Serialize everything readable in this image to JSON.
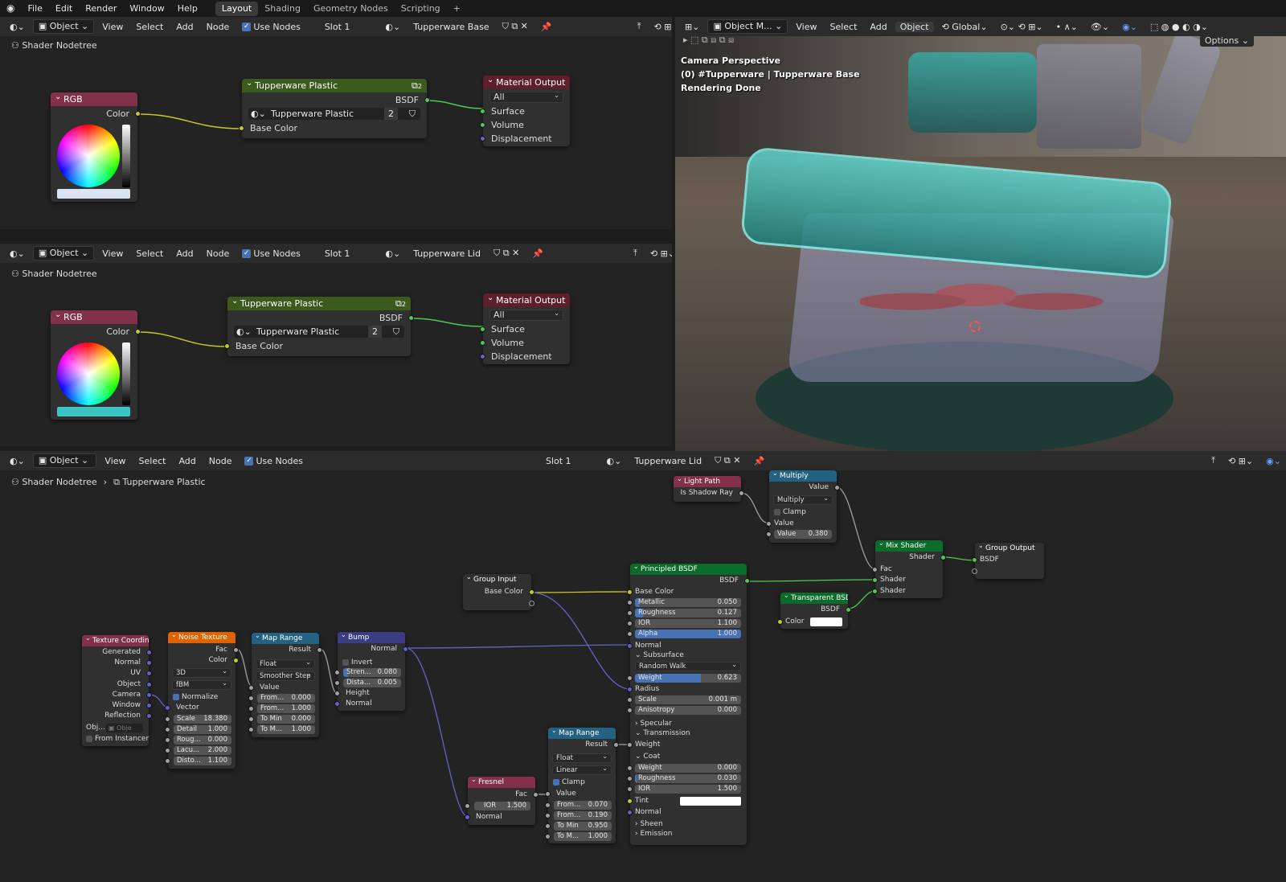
{
  "menu": {
    "items": [
      "File",
      "Edit",
      "Render",
      "Window",
      "Help"
    ],
    "workspaces": [
      "Layout",
      "Shading",
      "Geometry Nodes",
      "Scripting"
    ],
    "add_tab": "+"
  },
  "editor1": {
    "mode": "Object",
    "menus": [
      "View",
      "Select",
      "Add",
      "Node"
    ],
    "use_nodes": "Use Nodes",
    "slot": "Slot 1",
    "material": "Tupperware Base",
    "breadcrumb": "Shader Nodetree",
    "rgb": {
      "title": "RGB",
      "out": "Color",
      "swatch_color": "#dbe4f2"
    },
    "group": {
      "title": "Tupperware Plastic",
      "badge": "2",
      "out": "BSDF",
      "name": "Tupperware Plastic",
      "users": "2",
      "in": "Base Color"
    },
    "output": {
      "title": "Material Output",
      "target": "All",
      "inputs": [
        "Surface",
        "Volume",
        "Displacement"
      ]
    }
  },
  "editor2": {
    "mode": "Object",
    "menus": [
      "View",
      "Select",
      "Add",
      "Node"
    ],
    "use_nodes": "Use Nodes",
    "slot": "Slot 1",
    "material": "Tupperware Lid",
    "breadcrumb": "Shader Nodetree",
    "rgb": {
      "title": "RGB",
      "out": "Color",
      "swatch_color": "#3cc4c2"
    },
    "group": {
      "title": "Tupperware Plastic",
      "badge": "2",
      "out": "BSDF",
      "name": "Tupperware Plastic",
      "users": "2",
      "in": "Base Color"
    },
    "output": {
      "title": "Material Output",
      "target": "All",
      "inputs": [
        "Surface",
        "Volume",
        "Displacement"
      ]
    }
  },
  "viewport": {
    "mode": "Object M...",
    "menus": [
      "View",
      "Select",
      "Add",
      "Object"
    ],
    "orientation": "Global",
    "options": "Options",
    "overlay": [
      "Camera Perspective",
      "(0) #Tupperware | Tupperware Base",
      "Rendering Done"
    ]
  },
  "editor3": {
    "mode": "Object",
    "menus": [
      "View",
      "Select",
      "Add",
      "Node"
    ],
    "use_nodes": "Use Nodes",
    "slot": "Slot 1",
    "material": "Tupperware Lid",
    "breadcrumb": "Shader Nodetree",
    "breadcrumb2": "Tupperware Plastic",
    "texcoord": {
      "title": "Texture Coordin...",
      "outs": [
        "Generated",
        "Normal",
        "UV",
        "Object",
        "Camera",
        "Window",
        "Reflection"
      ],
      "obj": "Obj...",
      "obj_field": "Obje",
      "from_instancer": "From Instancer"
    },
    "noise": {
      "title": "Noise Texture",
      "outs": [
        "Fac",
        "Color"
      ],
      "dim": "3D",
      "type": "fBM",
      "normalize": "Normalize",
      "vector": "Vector",
      "fields": [
        {
          "l": "Scale",
          "v": "18.380"
        },
        {
          "l": "Detail",
          "v": "1.000"
        },
        {
          "l": "Roug...",
          "v": "0.000"
        },
        {
          "l": "Lacu...",
          "v": "2.000"
        },
        {
          "l": "Disto...",
          "v": "1.100"
        }
      ]
    },
    "maprange1": {
      "title": "Map Range",
      "out": "Result",
      "dtype": "Float",
      "interp": "Smoother Step",
      "value": "Value",
      "fields": [
        {
          "l": "From...",
          "v": "0.000"
        },
        {
          "l": "From...",
          "v": "1.000"
        },
        {
          "l": "To Min",
          "v": "0.000"
        },
        {
          "l": "To M...",
          "v": "1.000"
        }
      ]
    },
    "bump": {
      "title": "Bump",
      "out": "Normal",
      "invert": "Invert",
      "fields": [
        {
          "l": "Stren...",
          "v": "0.080"
        },
        {
          "l": "Dista...",
          "v": "0.005"
        }
      ],
      "ins": [
        "Height",
        "Normal"
      ]
    },
    "groupin": {
      "title": "Group Input",
      "out": "Base Color"
    },
    "fresnel": {
      "title": "Fresnel",
      "out": "Fac",
      "ior_l": "IOR",
      "ior_v": "1.500",
      "in": "Normal"
    },
    "maprange2": {
      "title": "Map Range",
      "out": "Result",
      "dtype": "Float",
      "interp": "Linear",
      "clamp": "Clamp",
      "value": "Value",
      "fields": [
        {
          "l": "From...",
          "v": "0.070"
        },
        {
          "l": "From...",
          "v": "0.190"
        },
        {
          "l": "To Min",
          "v": "0.950"
        },
        {
          "l": "To M...",
          "v": "1.000"
        }
      ]
    },
    "principled": {
      "title": "Principled BSDF",
      "out": "BSDF",
      "base": "Base Color",
      "fields": [
        {
          "l": "Metallic",
          "v": "0.050"
        },
        {
          "l": "Roughness",
          "v": "0.127"
        },
        {
          "l": "IOR",
          "v": "1.100"
        },
        {
          "l": "Alpha",
          "v": "1.000"
        }
      ],
      "normal": "Normal",
      "subsurface": "Subsurface",
      "ss_method": "Random Walk",
      "ss_fields": [
        {
          "l": "Weight",
          "v": "0.623"
        }
      ],
      "radius": "Radius",
      "ss_fields2": [
        {
          "l": "Scale",
          "v": "0.001 m"
        },
        {
          "l": "Anisotropy",
          "v": "0.000"
        }
      ],
      "specular": "Specular",
      "transmission": "Transmission",
      "weight": "Weight",
      "coat": "Coat",
      "coat_fields": [
        {
          "l": "Weight",
          "v": "0.000"
        },
        {
          "l": "Roughness",
          "v": "0.030"
        },
        {
          "l": "IOR",
          "v": "1.500"
        }
      ],
      "tint": "Tint",
      "normal2": "Normal",
      "sheen": "Sheen",
      "emission": "Emission"
    },
    "lightpath": {
      "title": "Light Path",
      "out": "Is Shadow Ray"
    },
    "multiply": {
      "title": "Multiply",
      "out": "Value",
      "op": "Multiply",
      "clamp": "Clamp",
      "in": "Value",
      "field": {
        "l": "Value",
        "v": "0.380"
      }
    },
    "mix": {
      "title": "Mix Shader",
      "out": "Shader",
      "ins": [
        "Fac",
        "Shader",
        "Shader"
      ]
    },
    "transparent": {
      "title": "Transparent BSDF",
      "out": "BSDF",
      "color": "Color"
    },
    "groupout": {
      "title": "Group Output",
      "in": "BSDF"
    }
  },
  "colors": {
    "wire_yellow": "#c7c729",
    "wire_green": "#4fc84f",
    "wire_gray": "#a1a1a1",
    "wire_blue": "#6363c7",
    "header_input": "#83314a",
    "header_group": "#3c5a1e",
    "header_output": "#5e1f2a",
    "header_texture": "#e06200",
    "header_converter": "#246283",
    "header_vector": "#3c3c83",
    "header_shader": "#0a6b2a",
    "accent": "#4772b3"
  }
}
